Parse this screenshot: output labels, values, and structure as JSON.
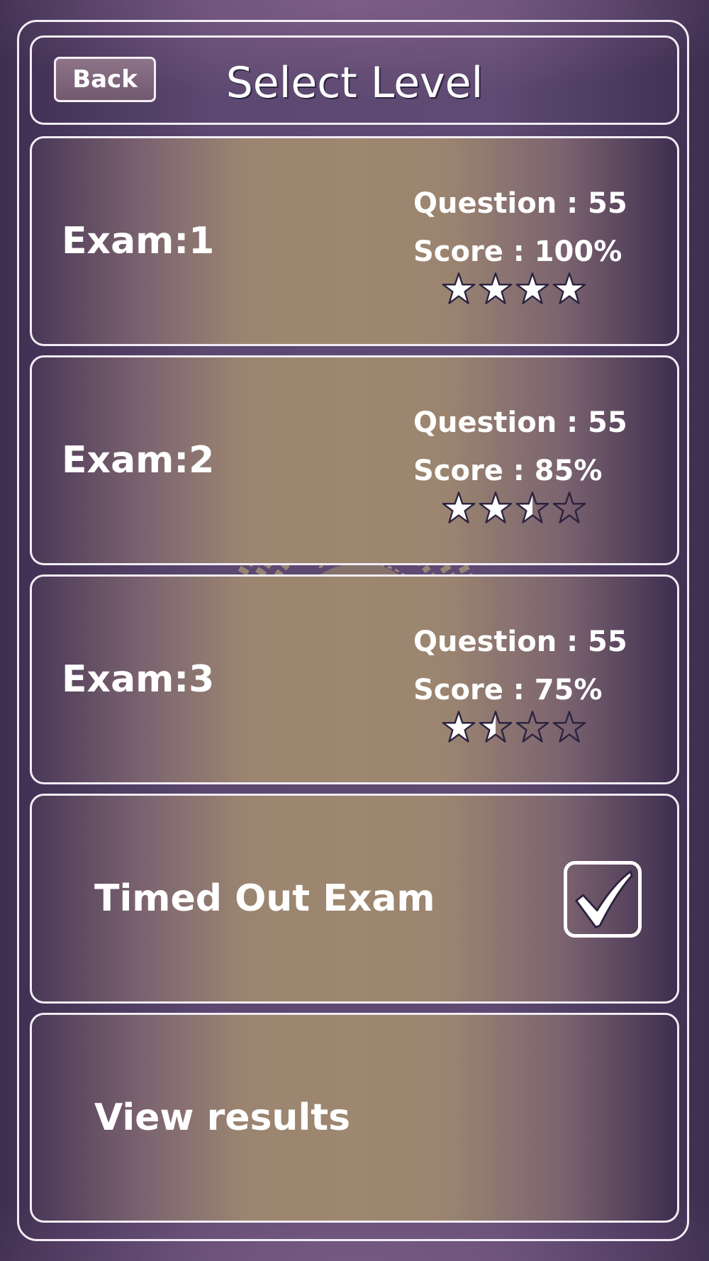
{
  "header": {
    "back_label": "Back",
    "title": "Select Level"
  },
  "exams": [
    {
      "title": "Exam:1",
      "question_text": "Question : 55",
      "score_text": "Score : 100%",
      "stars_rating": 4
    },
    {
      "title": "Exam:2",
      "question_text": "Question : 55",
      "score_text": "Score : 85%",
      "stars_rating": 2.5
    },
    {
      "title": "Exam:3",
      "question_text": "Question : 55",
      "score_text": "Score : 75%",
      "stars_rating": 1.5
    }
  ],
  "timed_out": {
    "label": "Timed Out Exam",
    "checked": true
  },
  "view_results": {
    "label": "View results"
  },
  "colors": {
    "border": "#f2ecf4",
    "text": "#ffffff",
    "star_fill": "#ffffff",
    "star_stroke": "#2d2340"
  },
  "icons": {
    "back": "back-button",
    "star": "star-icon",
    "checkbox": "checkmark-icon",
    "watermark": "brain-gears-head-logo"
  }
}
